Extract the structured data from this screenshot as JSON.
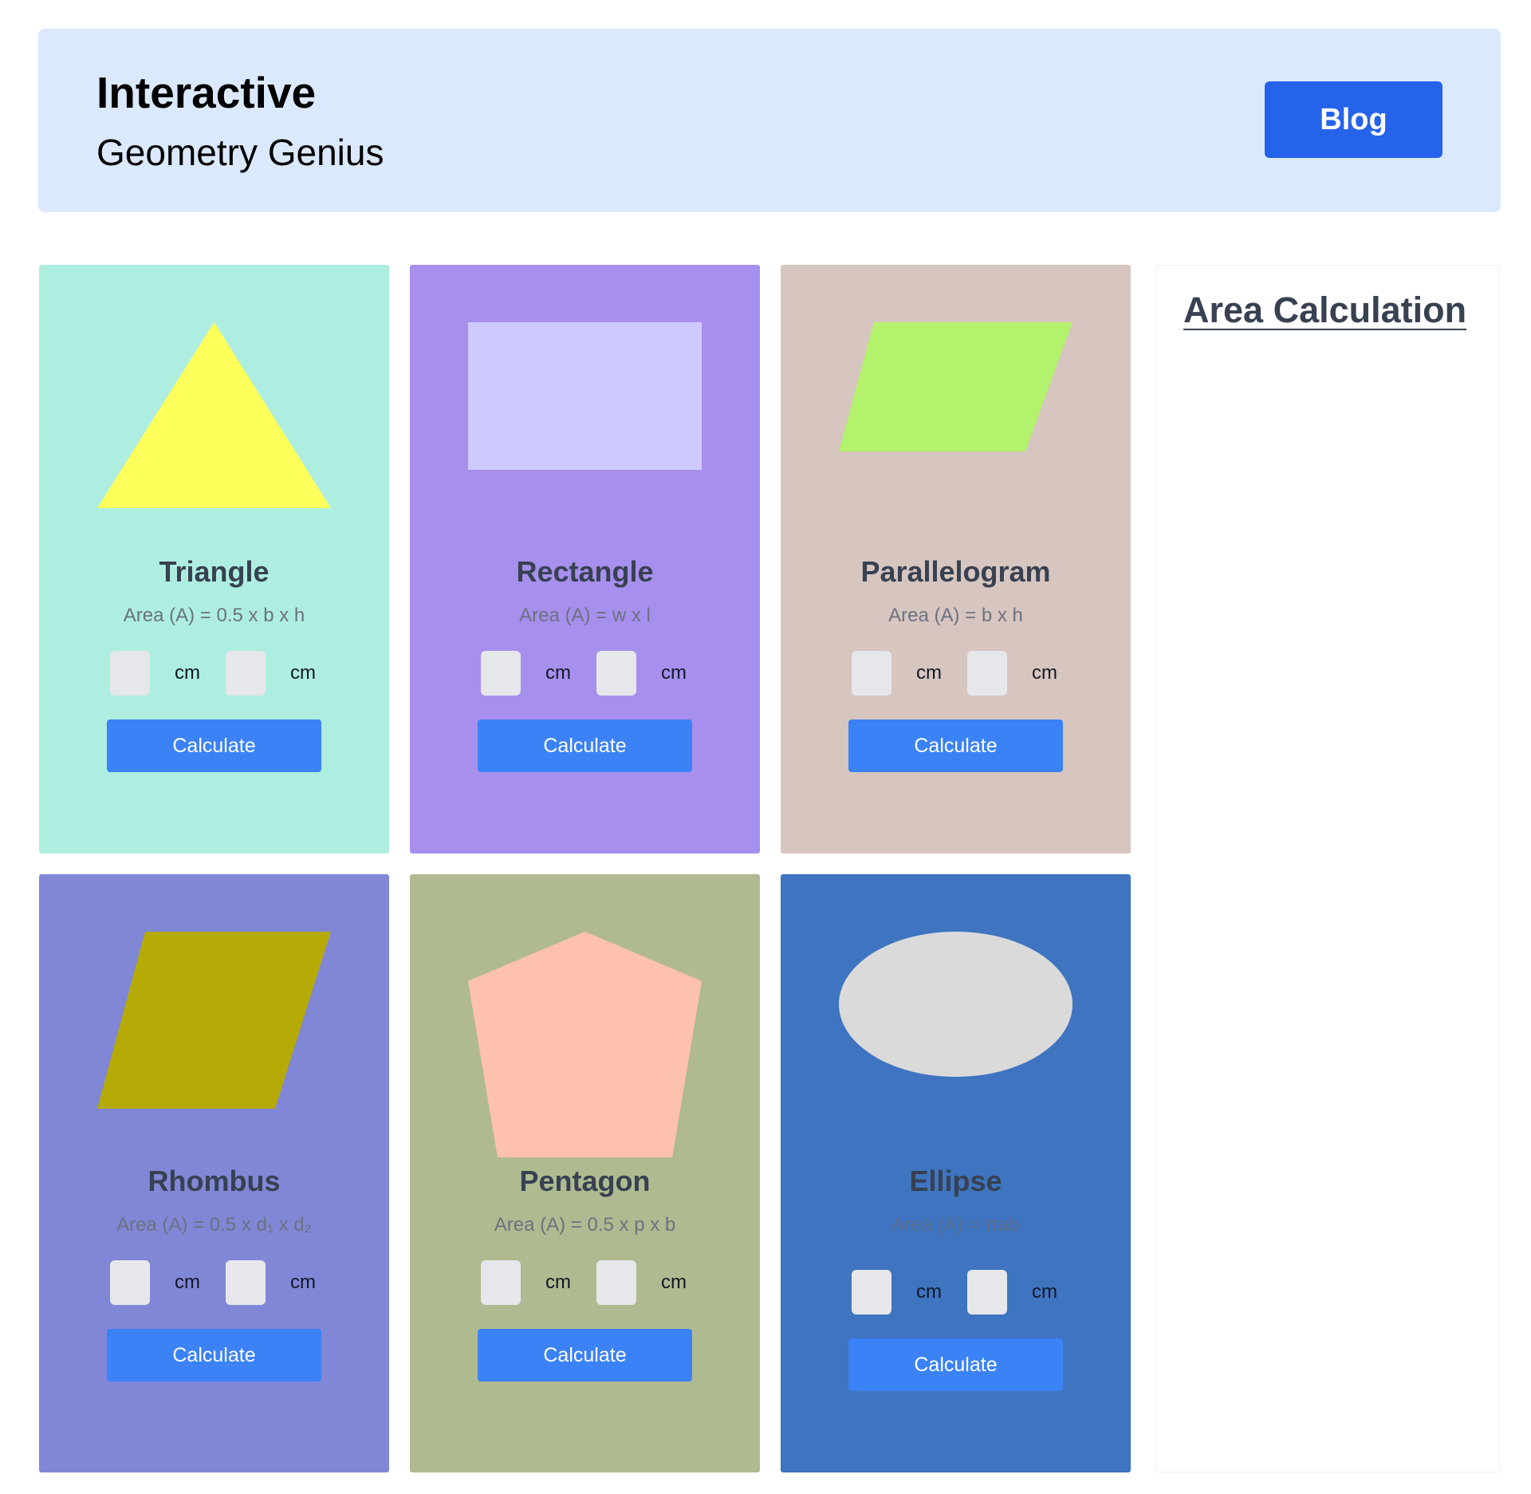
{
  "header": {
    "title": "Interactive",
    "subtitle": "Geometry Genius",
    "blog_label": "Blog",
    "background": "#dbe9fe",
    "accent": "#2563eb"
  },
  "cards": [
    {
      "shape": "triangle-icon",
      "title": "Triangle",
      "formula": "Area (A) = 0.5 x b x h",
      "unit_a": "cm",
      "unit_b": "cm",
      "button": "Calculate",
      "background": "#aeeee0",
      "shape_color": "#ffff5c"
    },
    {
      "shape": "rectangle-icon",
      "title": "Rectangle",
      "formula": "Area (A) = w x l",
      "unit_a": "cm",
      "unit_b": "cm",
      "button": "Calculate",
      "background": "#a78fed",
      "shape_color": "#cdcbfd"
    },
    {
      "shape": "parallelogram-icon",
      "title": "Parallelogram",
      "formula": "Area (A) = b x h",
      "unit_a": "cm",
      "unit_b": "cm",
      "button": "Calculate",
      "background": "#d7c5bf",
      "shape_color": "#b3f26c"
    },
    {
      "shape": "rhombus-icon",
      "title": "Rhombus",
      "formula": "Area (A) = 0.5 x d₁ x d₂",
      "unit_a": "cm",
      "unit_b": "cm",
      "button": "Calculate",
      "background": "#8087d6",
      "shape_color": "#b5aa06"
    },
    {
      "shape": "pentagon-icon",
      "title": "Pentagon",
      "formula": "Area (A) = 0.5 x p x b",
      "unit_a": "cm",
      "unit_b": "cm",
      "button": "Calculate",
      "background": "#b0ba90",
      "shape_color": "#fec1ae"
    },
    {
      "shape": "ellipse-icon",
      "title": "Ellipse",
      "formula": "Area (A) = πab",
      "unit_a": "cm",
      "unit_b": "cm",
      "button": "Calculate",
      "background": "#3e74c0",
      "shape_color": "#dadadb"
    }
  ],
  "side_panel": {
    "title": "Area Calculation"
  },
  "colors": {
    "button": "#3b82f6",
    "input": "#e5e7eb",
    "title_text": "#374151"
  }
}
